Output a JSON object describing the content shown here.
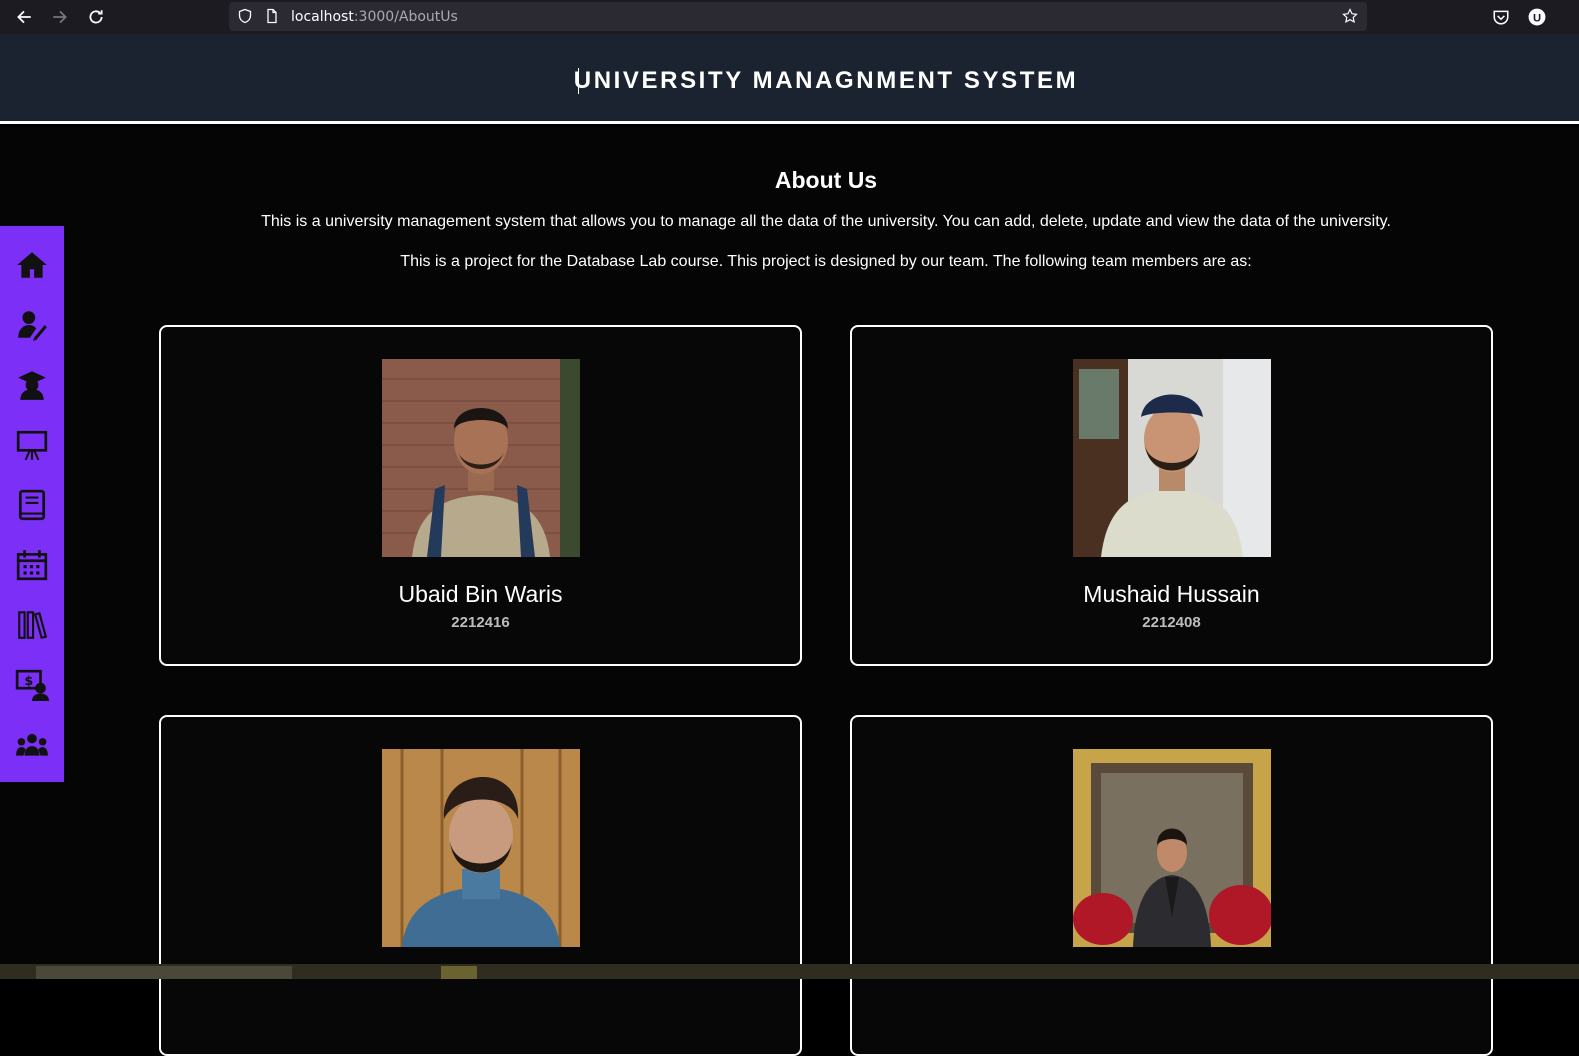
{
  "browser": {
    "url_host": "localhost",
    "url_path": ":3000/AboutUs"
  },
  "header": {
    "title": "UNIVERSITY MANAGNMENT SYSTEM"
  },
  "about": {
    "title": "About Us",
    "paragraph1": "This is a university management system that allows you to manage all the data of the university. You can add, delete, update and view the data of the university.",
    "paragraph2": "This is a project for the Database Lab course. This project is designed by our team. The following team members are as:"
  },
  "team": [
    {
      "name": "Ubaid Bin Waris",
      "id": "2212416"
    },
    {
      "name": "Mushaid Hussain",
      "id": "2212408"
    },
    {
      "name": "",
      "id": ""
    },
    {
      "name": "",
      "id": ""
    }
  ],
  "sidebar": {
    "items": [
      {
        "icon": "home-icon"
      },
      {
        "icon": "teacher-icon"
      },
      {
        "icon": "student-icon"
      },
      {
        "icon": "presentation-icon"
      },
      {
        "icon": "book-icon"
      },
      {
        "icon": "calendar-icon"
      },
      {
        "icon": "library-icon"
      },
      {
        "icon": "fee-icon"
      },
      {
        "icon": "team-icon"
      }
    ]
  },
  "colors": {
    "sidebar": "#7b2ff7",
    "header": "#1b2330",
    "background": "#050505"
  }
}
